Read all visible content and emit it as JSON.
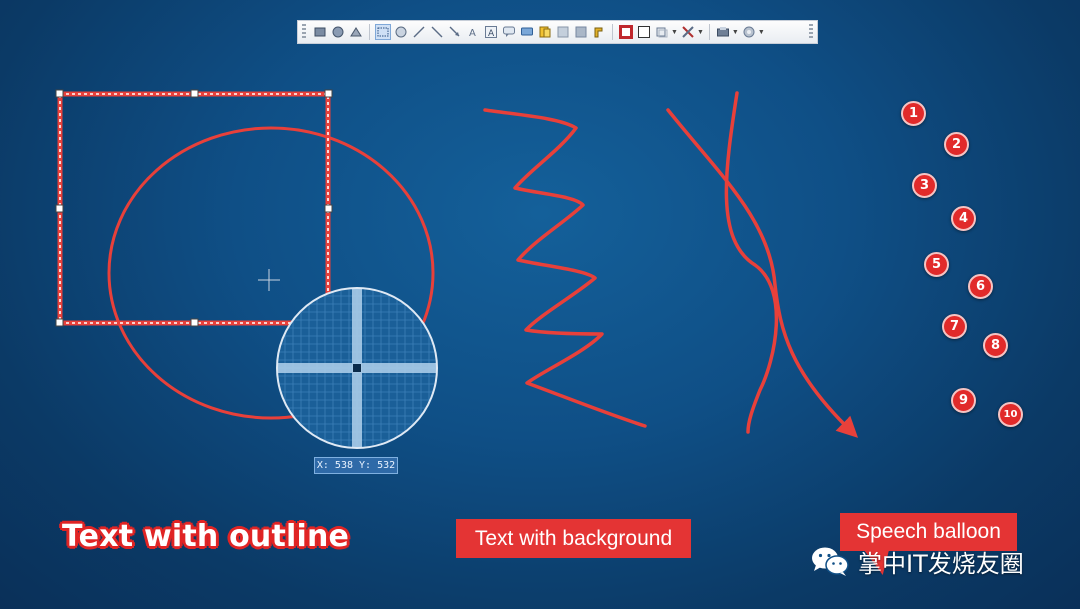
{
  "toolbar": {
    "tools": [
      {
        "name": "select-tool-icon"
      },
      {
        "name": "shape-tool-icon"
      },
      {
        "name": "hand-tool-icon"
      },
      {
        "name": "rectangle-tool-icon",
        "active": true
      },
      {
        "name": "ellipse-tool-icon"
      },
      {
        "name": "line-tool-icon"
      },
      {
        "name": "pen-tool-icon"
      },
      {
        "name": "arrow-tool-icon"
      },
      {
        "name": "text-outline-tool-icon"
      },
      {
        "name": "text-background-tool-icon"
      },
      {
        "name": "speech-balloon-tool-icon"
      },
      {
        "name": "callout-tool-icon"
      },
      {
        "name": "stamp-tool-icon"
      },
      {
        "name": "highlight-tool-icon"
      },
      {
        "name": "blur-tool-icon"
      },
      {
        "name": "pixelate-tool-icon"
      },
      {
        "name": "marker-tool-icon"
      }
    ],
    "colors": {
      "border": "#c0282d",
      "fill": "#ffffff"
    }
  },
  "magnifier": {
    "coords": "X: 538 Y: 532"
  },
  "numbers": [
    "1",
    "2",
    "3",
    "4",
    "5",
    "6",
    "7",
    "8",
    "9",
    "10"
  ],
  "labels": {
    "outline": "Text with outline",
    "background": "Text with background",
    "balloon": "Speech balloon"
  },
  "watermark": "掌中IT发烧友圈",
  "accent": "#e43434"
}
